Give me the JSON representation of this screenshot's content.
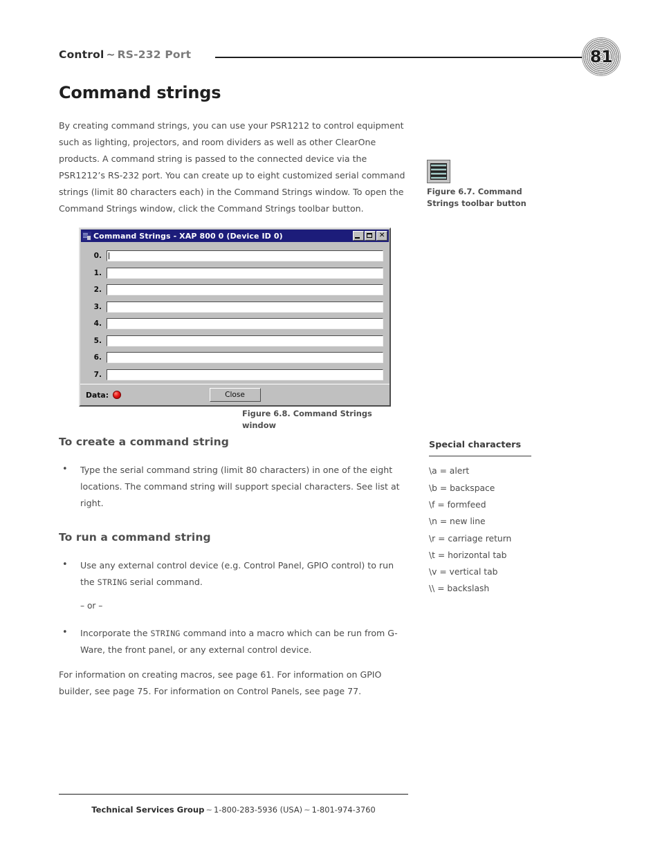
{
  "header": {
    "running_head_strong": "Control",
    "running_head_tilde": "~",
    "running_head_light": "RS-232 Port",
    "page_number": "81"
  },
  "page_title": "Command strings",
  "intro_paragraph": "By creating command strings, you can use your PSR1212 to control equipment such as lighting, projectors, and room dividers as well as other ClearOne products. A command string is passed to the connected device via the PSR1212’s RS-232 port. You can create up to eight customized serial command strings (limit 80 characters each) in the Command Strings window. To open the Command Strings window, click the Command Strings toolbar button.",
  "figure_6_7": {
    "caption": "Figure 6.7. Command Strings toolbar button",
    "icon": "command-strings-toolbar-icon",
    "bar_count": 4
  },
  "figure_6_8": {
    "caption": "Figure 6.8. Command Strings window"
  },
  "dialog": {
    "title": "Command Strings - XAP 800 0 (Device ID 0)",
    "app_icon": "app-icon",
    "titlebar_color": "#1c1c7a",
    "window_buttons": [
      {
        "name": "minimize-button",
        "glyph": "_"
      },
      {
        "name": "maximize-button",
        "glyph": "□"
      },
      {
        "name": "close-button",
        "glyph": "✕"
      }
    ],
    "rows": [
      {
        "label": "0.",
        "value": "",
        "focused": true
      },
      {
        "label": "1.",
        "value": "",
        "focused": false
      },
      {
        "label": "2.",
        "value": "",
        "focused": false
      },
      {
        "label": "3.",
        "value": "",
        "focused": false
      },
      {
        "label": "4.",
        "value": "",
        "focused": false
      },
      {
        "label": "5.",
        "value": "",
        "focused": false
      },
      {
        "label": "6.",
        "value": "",
        "focused": false
      },
      {
        "label": "7.",
        "value": "",
        "focused": false
      }
    ],
    "status": {
      "data_label": "Data:",
      "led_color": "#e81717",
      "led_name": "data-led-indicator"
    },
    "close_label": "Close"
  },
  "sections": [
    {
      "heading": "To create a command string",
      "bullets": [
        {
          "type": "bullet",
          "text": "Type the serial command string (limit 80 characters) in one of the eight locations. The command string will support special characters. See list at right."
        }
      ]
    },
    {
      "heading": "To run a command string",
      "bullets": [
        {
          "type": "bullet",
          "pre": "Use any external control device (e.g. Control Panel, GPIO control) to run the ",
          "mono": "STRING",
          "post": " serial command."
        },
        {
          "type": "or",
          "text": "– or –"
        },
        {
          "type": "bullet",
          "pre": "Incorporate the ",
          "mono": "STRING",
          "post": " command into a macro which can be run from G-Ware, the front panel, or any external control device."
        }
      ]
    }
  ],
  "closing_paragraph": "For information on creating macros, see page 61. For information on GPIO builder, see page 75. For information on Control Panels, see page 77.",
  "sidebar": {
    "heading": "Special characters",
    "items": [
      "\\a = alert",
      "\\b = backspace",
      "\\f = formfeed",
      "\\n = new line",
      "\\r = carriage return",
      "\\t = horizontal tab",
      "\\v = vertical tab",
      "\\\\ = backslash"
    ]
  },
  "footer": {
    "bold": "Technical Services Group",
    "tilde1": "~",
    "phone_usa": "1-800-283-5936 (USA)",
    "tilde2": "~",
    "phone_intl": "1-801-974-3760"
  }
}
